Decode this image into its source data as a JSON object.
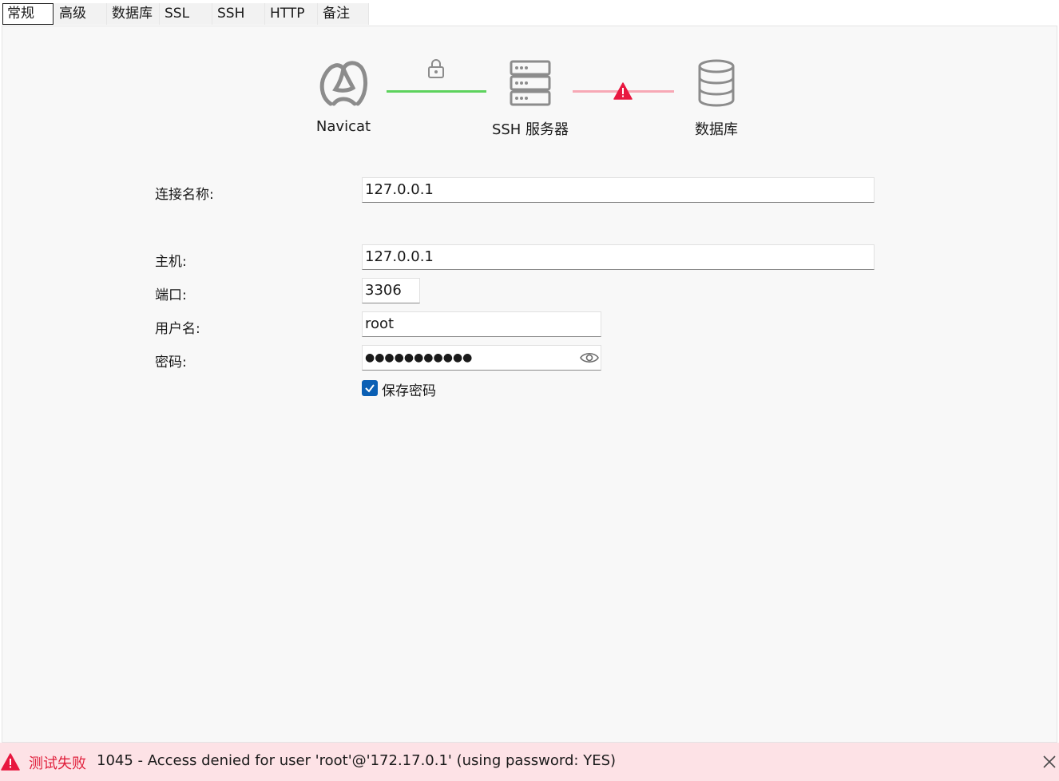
{
  "tabs": [
    {
      "label": "常规",
      "active": true
    },
    {
      "label": "高级"
    },
    {
      "label": "数据库"
    },
    {
      "label": "SSL"
    },
    {
      "label": "SSH"
    },
    {
      "label": "HTTP"
    },
    {
      "label": "备注"
    }
  ],
  "diagram": {
    "navicat_label": "Navicat",
    "ssh_label": "SSH 服务器",
    "db_label": "数据库",
    "link1_status": "connected",
    "link2_status": "error",
    "colors": {
      "ok_line": "#5dd35d",
      "error_line": "#f7a8b5",
      "error_icon": "#e8173f",
      "icon": "#8c8c8c"
    },
    "icons": [
      "navicat-logo-icon",
      "lock-icon",
      "server-icon",
      "warning-icon",
      "database-icon"
    ]
  },
  "form": {
    "connection_name": {
      "label": "连接名称:",
      "value": "127.0.0.1"
    },
    "host": {
      "label": "主机:",
      "value": "127.0.0.1"
    },
    "port": {
      "label": "端口:",
      "value": "3306"
    },
    "username": {
      "label": "用户名:",
      "value": "root"
    },
    "password": {
      "label": "密码:",
      "value": "●●●●●●●●●●●"
    },
    "save_password": {
      "label": "保存密码",
      "checked": true
    }
  },
  "status_bar": {
    "title": "测试失败",
    "message": "1045 - Access denied for user 'root'@'172.17.0.1' (using password: YES)",
    "accent": "#e0203c",
    "background": "#fde2e6"
  }
}
